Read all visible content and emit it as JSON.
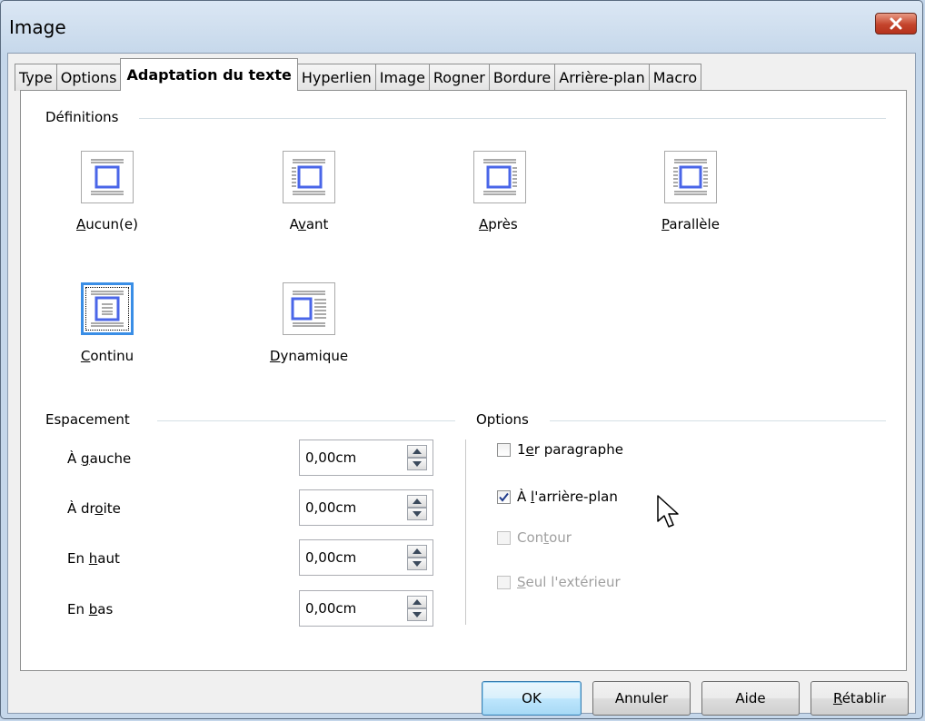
{
  "window": {
    "title": "Image"
  },
  "tabs": [
    {
      "label": "Type"
    },
    {
      "label": "Options"
    },
    {
      "label": "Adaptation du texte",
      "active": true
    },
    {
      "label": "Hyperlien"
    },
    {
      "label": "Image"
    },
    {
      "label": "Rogner"
    },
    {
      "label": "Bordure"
    },
    {
      "label": "Arrière-plan"
    },
    {
      "label": "Macro"
    }
  ],
  "definitions": {
    "heading": "Définitions",
    "items": [
      {
        "label": "Aucun(e)",
        "mnemonic": "A",
        "rest": "ucun(e)",
        "icon": "wrap-none-icon"
      },
      {
        "label": "Avant",
        "pre": "A",
        "mnemonic": "v",
        "rest": "ant",
        "icon": "wrap-before-icon"
      },
      {
        "label": "Après",
        "mnemonic": "A",
        "rest": "près",
        "icon": "wrap-after-icon"
      },
      {
        "label": "Parallèle",
        "mnemonic": "P",
        "rest": "arallèle",
        "icon": "wrap-parallel-icon"
      },
      {
        "label": "Continu",
        "mnemonic": "C",
        "rest": "ontinu",
        "icon": "wrap-through-icon",
        "selected": true
      },
      {
        "label": "Dynamique",
        "mnemonic": "D",
        "rest": "ynamique",
        "icon": "wrap-optimal-icon"
      }
    ]
  },
  "spacing": {
    "heading": "Espacement",
    "rows": [
      {
        "pre": "À ",
        "mnemonic": "g",
        "rest": "auche",
        "value": "0,00cm"
      },
      {
        "pre": "À dr",
        "mnemonic": "o",
        "rest": "ite",
        "value": "0,00cm"
      },
      {
        "pre": "En ",
        "mnemonic": "h",
        "rest": "aut",
        "value": "0,00cm"
      },
      {
        "pre": "En ",
        "mnemonic": "b",
        "rest": "as",
        "value": "0,00cm"
      }
    ]
  },
  "options": {
    "heading": "Options",
    "items": [
      {
        "pre": "1",
        "mnemonic": "e",
        "rest": "r paragraphe",
        "checked": false,
        "enabled": true
      },
      {
        "pre": "À ",
        "mnemonic": "l",
        "rest": "'arrière-plan",
        "checked": true,
        "enabled": true
      },
      {
        "pre": "Con",
        "mnemonic": "t",
        "rest": "our",
        "checked": false,
        "enabled": false
      },
      {
        "pre": "",
        "mnemonic": "S",
        "rest": "eul l'extérieur",
        "checked": false,
        "enabled": false
      }
    ]
  },
  "buttons": {
    "ok": "OK",
    "cancel": "Annuler",
    "help": "Aide",
    "reset_mnemonic": "R",
    "reset_rest": "établir"
  },
  "colors": {
    "accent": "#3a8ee6",
    "icon_blue": "#4a66e8",
    "title_bg": "#c4d6ea",
    "close": "#c4442c"
  }
}
